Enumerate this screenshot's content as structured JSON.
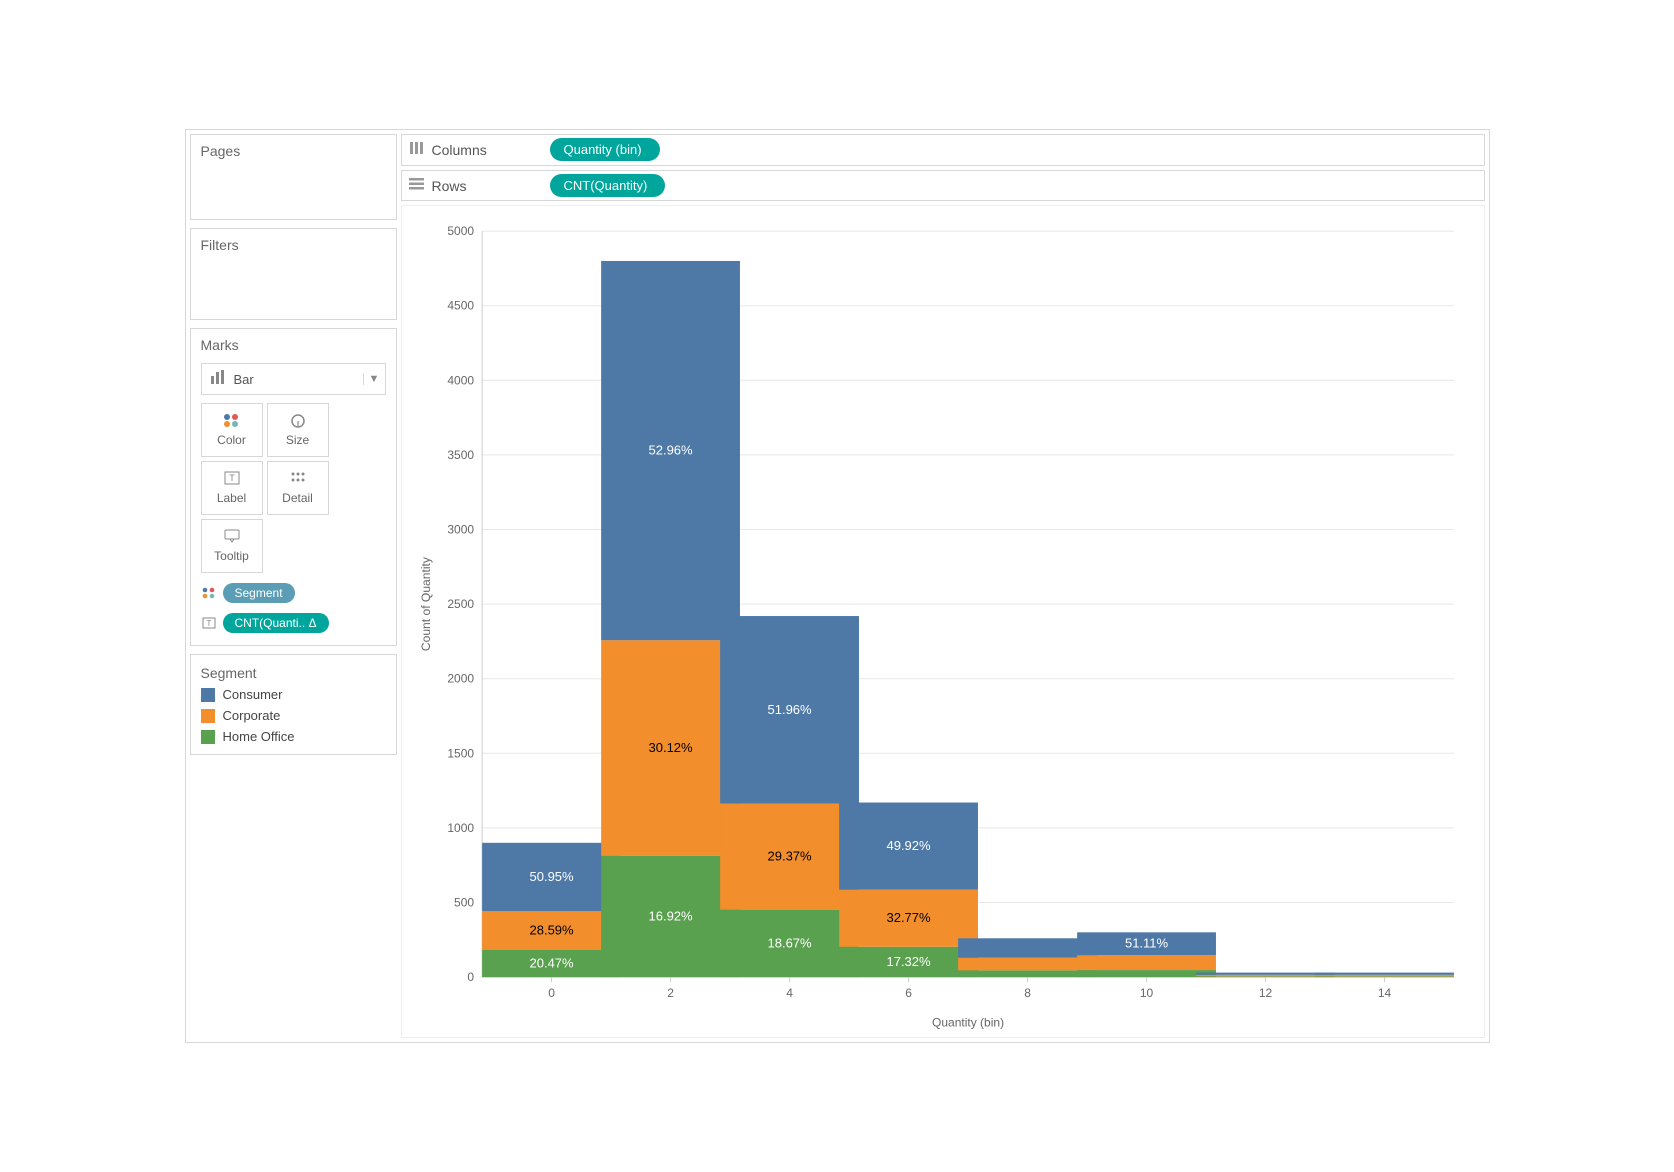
{
  "shelves": {
    "columns_label": "Columns",
    "rows_label": "Rows",
    "columns_pill": "Quantity (bin)",
    "rows_pill": "CNT(Quantity)"
  },
  "panels": {
    "pages": "Pages",
    "filters": "Filters",
    "marks": "Marks",
    "marks_type": "Bar",
    "cells": {
      "color": "Color",
      "size": "Size",
      "label": "Label",
      "detail": "Detail",
      "tooltip": "Tooltip"
    },
    "pill_segment": "Segment",
    "pill_cnt": "CNT(Quanti.. Δ"
  },
  "legend": {
    "title": "Segment",
    "items": [
      {
        "label": "Consumer",
        "color": "#4e79a7"
      },
      {
        "label": "Corporate",
        "color": "#f28e2b"
      },
      {
        "label": "Home Office",
        "color": "#59a14f"
      }
    ]
  },
  "chart_data": {
    "type": "bar",
    "xlabel": "Quantity (bin)",
    "ylabel": "Count of Quantity",
    "ylim": [
      0,
      5000
    ],
    "yticks": [
      0,
      500,
      1000,
      1500,
      2000,
      2500,
      3000,
      3500,
      4000,
      4500,
      5000
    ],
    "xticks": [
      0,
      2,
      4,
      6,
      8,
      10,
      12,
      14
    ],
    "colors": {
      "Consumer": "#4e79a7",
      "Corporate": "#f28e2b",
      "Home Office": "#59a14f"
    },
    "bins": [
      {
        "x": 0,
        "total": 900,
        "segments": [
          {
            "name": "Consumer",
            "value": 459,
            "pct": "50.95%"
          },
          {
            "name": "Corporate",
            "value": 257,
            "pct": "28.59%"
          },
          {
            "name": "Home Office",
            "value": 184,
            "pct": "20.47%"
          }
        ]
      },
      {
        "x": 2,
        "total": 4800,
        "segments": [
          {
            "name": "Consumer",
            "value": 2542,
            "pct": "52.96%"
          },
          {
            "name": "Corporate",
            "value": 1446,
            "pct": "30.12%"
          },
          {
            "name": "Home Office",
            "value": 812,
            "pct": "16.92%"
          }
        ]
      },
      {
        "x": 4,
        "total": 2420,
        "segments": [
          {
            "name": "Consumer",
            "value": 1257,
            "pct": "51.96%"
          },
          {
            "name": "Corporate",
            "value": 711,
            "pct": "29.37%"
          },
          {
            "name": "Home Office",
            "value": 452,
            "pct": "18.67%"
          }
        ]
      },
      {
        "x": 6,
        "total": 1170,
        "segments": [
          {
            "name": "Consumer",
            "value": 584,
            "pct": "49.92%"
          },
          {
            "name": "Corporate",
            "value": 383,
            "pct": "32.77%"
          },
          {
            "name": "Home Office",
            "value": 203,
            "pct": "17.32%"
          }
        ]
      },
      {
        "x": 8,
        "total": 260,
        "segments": [
          {
            "name": "Consumer",
            "value": 130,
            "pct": ""
          },
          {
            "name": "Corporate",
            "value": 85,
            "pct": ""
          },
          {
            "name": "Home Office",
            "value": 45,
            "pct": ""
          }
        ]
      },
      {
        "x": 10,
        "total": 300,
        "segments": [
          {
            "name": "Consumer",
            "value": 153,
            "pct": "51.11%"
          },
          {
            "name": "Corporate",
            "value": 100,
            "pct": ""
          },
          {
            "name": "Home Office",
            "value": 47,
            "pct": ""
          }
        ]
      },
      {
        "x": 12,
        "total": 30,
        "segments": [
          {
            "name": "Consumer",
            "value": 15,
            "pct": ""
          },
          {
            "name": "Corporate",
            "value": 10,
            "pct": ""
          },
          {
            "name": "Home Office",
            "value": 5,
            "pct": ""
          }
        ]
      },
      {
        "x": 14,
        "total": 30,
        "segments": [
          {
            "name": "Consumer",
            "value": 15,
            "pct": ""
          },
          {
            "name": "Corporate",
            "value": 10,
            "pct": ""
          },
          {
            "name": "Home Office",
            "value": 5,
            "pct": ""
          }
        ]
      }
    ]
  }
}
